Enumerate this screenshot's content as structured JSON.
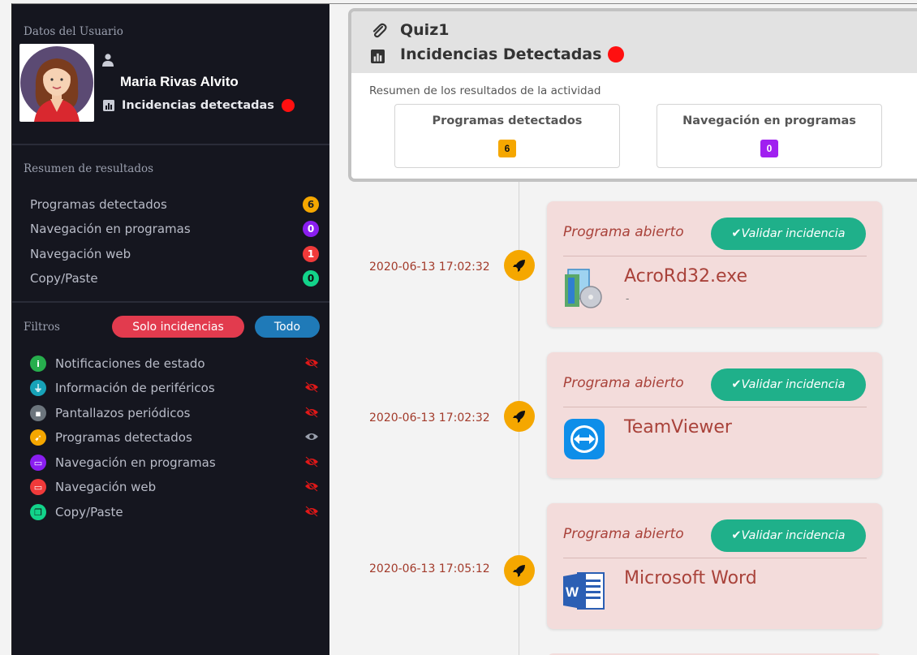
{
  "sidebar": {
    "user_section_title": "Datos del Usuario",
    "user_name": "Maria Rivas Alvito",
    "incidencias_label": "Incidencias detectadas",
    "resumen_title": "Resumen de resultados",
    "results": [
      {
        "label": "Programas detectados",
        "count": "6",
        "color": "#f5a700"
      },
      {
        "label": "Navegación en programas",
        "count": "0",
        "color": "#8a1ef0"
      },
      {
        "label": "Navegación web",
        "count": "1",
        "color": "#f03a3a"
      },
      {
        "label": "Copy/Paste",
        "count": "0",
        "color": "#12d38a"
      }
    ],
    "filters_title": "Filtros",
    "filter_solo_label": "Solo incidencias",
    "filter_todo_label": "Todo",
    "filter_items": [
      {
        "label": "Notificaciones de estado",
        "color": "#27ae4d",
        "icon": "info-icon",
        "visible": false
      },
      {
        "label": "Información de periféricos",
        "color": "#17a2b8",
        "icon": "plug-icon",
        "visible": false
      },
      {
        "label": "Pantallazos periódicos",
        "color": "#6c757d",
        "icon": "image-icon",
        "visible": false
      },
      {
        "label": "Programas detectados",
        "color": "#f5a700",
        "icon": "rocket-icon",
        "visible": true
      },
      {
        "label": "Navegación en programas",
        "color": "#8a1ef0",
        "icon": "window-icon",
        "visible": false
      },
      {
        "label": "Navegación web",
        "color": "#f03a3a",
        "icon": "browser-icon",
        "visible": false
      },
      {
        "label": "Copy/Paste",
        "color": "#12d38a",
        "icon": "copy-icon",
        "visible": false
      }
    ]
  },
  "main": {
    "quiz_title": "Quiz1",
    "quiz_subtitle": "Incidencias Detectadas",
    "resumen_text": "Resumen de los resultados de la actividad",
    "stats": [
      {
        "label": "Programas detectados",
        "value": "6",
        "color": "#f5a700"
      },
      {
        "label": "Navegación en programas",
        "value": "0",
        "color": "#a020f0"
      }
    ],
    "events": [
      {
        "timestamp": "2020-06-13 17:02:32",
        "type": "Programa abierto",
        "validate_label": "✔Validar incidencia",
        "app_name": "AcroRd32.exe",
        "app_sub": "-",
        "icon": "acrobat-icon"
      },
      {
        "timestamp": "2020-06-13 17:02:32",
        "type": "Programa abierto",
        "validate_label": "✔Validar incidencia",
        "app_name": "TeamViewer",
        "app_sub": "",
        "icon": "teamviewer-icon"
      },
      {
        "timestamp": "2020-06-13 17:05:12",
        "type": "Programa abierto",
        "validate_label": "✔Validar incidencia",
        "app_name": "Microsoft Word",
        "app_sub": "",
        "icon": "word-icon"
      }
    ]
  }
}
